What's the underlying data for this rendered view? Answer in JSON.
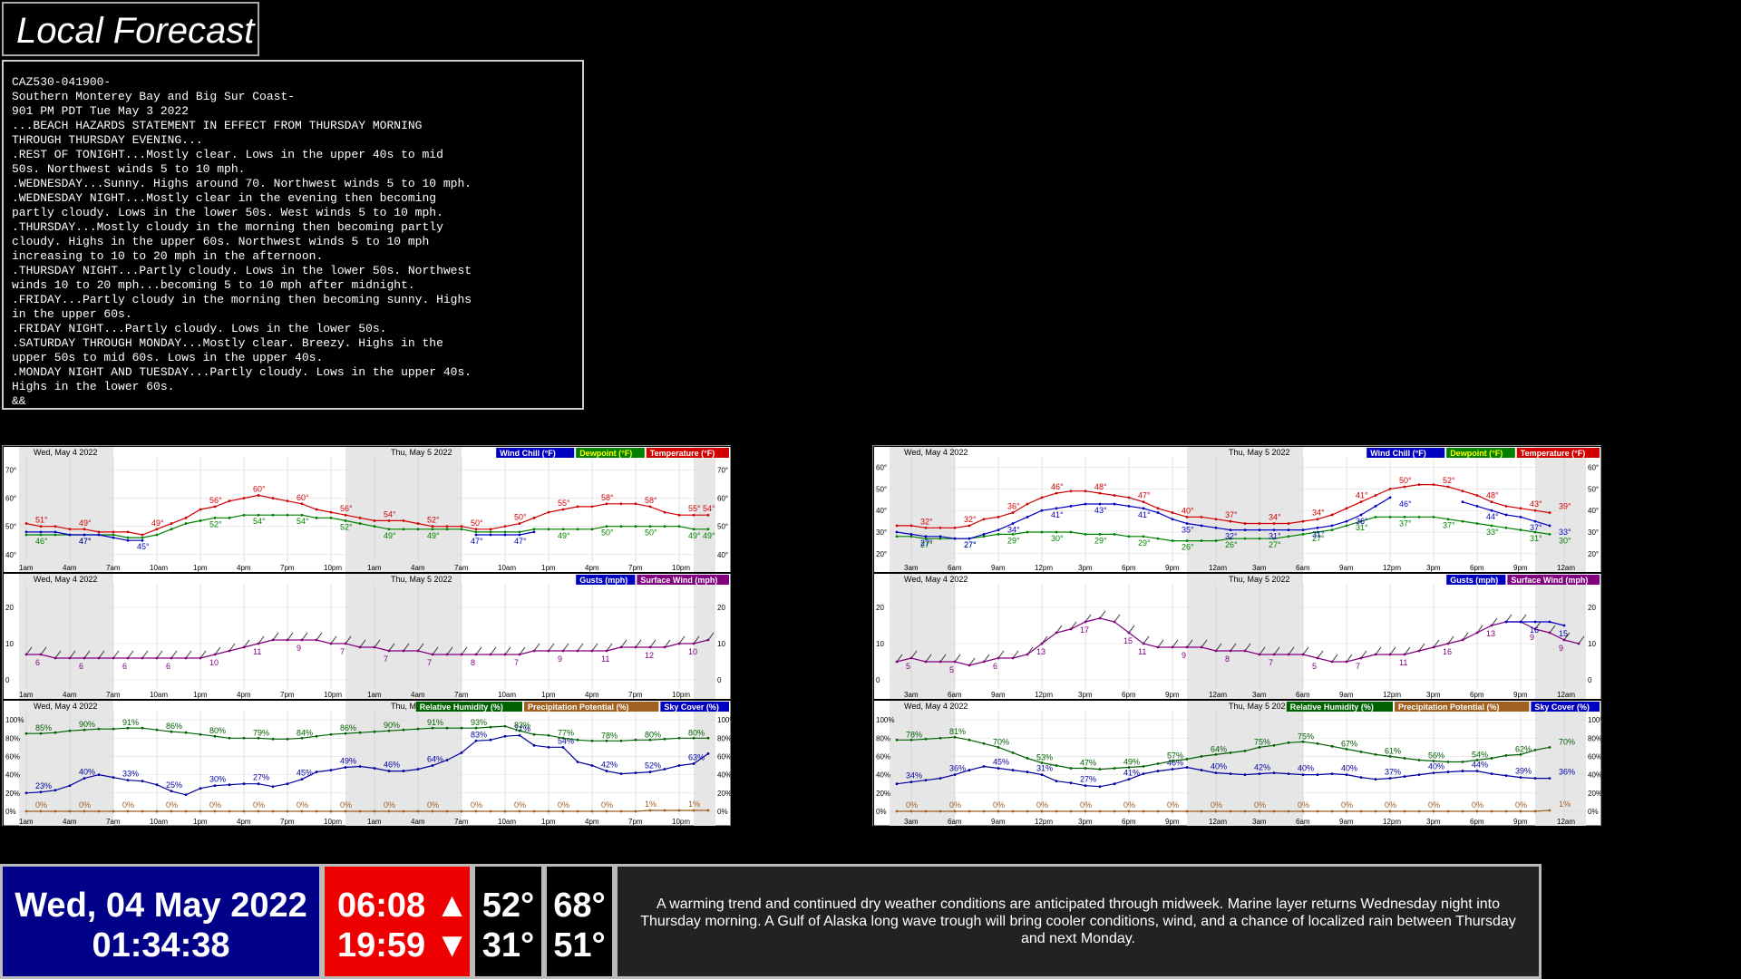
{
  "title": "Local Forecast",
  "afd_lines": [
    "CAZ530-041900-",
    "Southern Monterey Bay and Big Sur Coast-",
    "901 PM PDT Tue May 3 2022",
    "...BEACH HAZARDS STATEMENT IN EFFECT FROM THURSDAY MORNING",
    "THROUGH THURSDAY EVENING...",
    ".REST OF TONIGHT...Mostly clear. Lows in the upper 40s to mid",
    "50s. Northwest winds 5 to 10 mph.",
    ".WEDNESDAY...Sunny. Highs around 70. Northwest winds 5 to 10 mph.",
    ".WEDNESDAY NIGHT...Mostly clear in the evening then becoming",
    "partly cloudy. Lows in the lower 50s. West winds 5 to 10 mph.",
    ".THURSDAY...Mostly cloudy in the morning then becoming partly",
    "cloudy. Highs in the upper 60s. Northwest winds 5 to 10 mph",
    "increasing to 10 to 20 mph in the afternoon.",
    ".THURSDAY NIGHT...Partly cloudy. Lows in the lower 50s. Northwest",
    "winds 10 to 20 mph...becoming 5 to 10 mph after midnight.",
    ".FRIDAY...Partly cloudy in the morning then becoming sunny. Highs",
    "in the upper 60s.",
    ".FRIDAY NIGHT...Partly cloudy. Lows in the lower 50s.",
    ".SATURDAY THROUGH MONDAY...Mostly clear. Breezy. Highs in the",
    "upper 50s to mid 60s. Lows in the upper 40s.",
    ".MONDAY NIGHT AND TUESDAY...Partly cloudy. Lows in the upper 40s.",
    "Highs in the lower 60s.",
    "&&"
  ],
  "charts": [
    {
      "day1_label": "Wed, May 4 2022",
      "day2_label": "Thu, May 5 2022",
      "day2_label_short": "Thu, Ma",
      "time_labels": [
        "1am",
        "4am",
        "7am",
        "10am",
        "1pm",
        "4pm",
        "7pm",
        "10pm",
        "1am",
        "4am",
        "7am",
        "10am",
        "1pm",
        "4pm",
        "7pm",
        "10pm"
      ],
      "temp_axis": {
        "labels": [
          "70°",
          "60°",
          "50°",
          "40°"
        ],
        "values": [
          70,
          60,
          50,
          40
        ],
        "min": 38,
        "max": 74
      },
      "temp_legend": [
        "Wind Chill (°F)",
        "Dewpoint (°F)",
        "Temperature (°F)"
      ],
      "temperature": [
        51,
        50,
        50,
        49,
        49,
        48,
        48,
        48,
        47,
        49,
        51,
        53,
        56,
        57,
        59,
        60,
        61,
        60,
        59,
        58,
        56,
        55,
        54,
        53,
        52,
        52,
        52,
        51,
        50,
        50,
        50,
        49,
        49,
        50,
        51,
        53,
        55,
        56,
        57,
        57,
        58,
        58,
        58,
        57,
        55,
        54,
        54,
        54
      ],
      "temperature_labels": {
        "1": "51°",
        "4": "49°",
        "9": "49°",
        "13": "56°",
        "16": "60°",
        "19": "60°",
        "22": "56°",
        "25": "54°",
        "28": "52°",
        "31": "50°",
        "34": "50°",
        "37": "55°",
        "40": "58°",
        "43": "58°",
        "46": "55°",
        "47": "54°"
      },
      "windchill": [
        48,
        48,
        48,
        47,
        47,
        47,
        46,
        45,
        45
      ],
      "windchill_labels": {
        "4": "47°",
        "8": "45°"
      },
      "windchill2": [
        null,
        null,
        null,
        null,
        null,
        null,
        null,
        null,
        null,
        null,
        null,
        null,
        null,
        null,
        null,
        null,
        null,
        null,
        null,
        null,
        null,
        null,
        null,
        null,
        null,
        null,
        null,
        null,
        null,
        null,
        null,
        47,
        47,
        47,
        47,
        48
      ],
      "windchill2_labels": {
        "31": "47°",
        "34": "47°"
      },
      "dewpoint": [
        47,
        47,
        47,
        47,
        47,
        47,
        47,
        46,
        46,
        47,
        49,
        51,
        52,
        53,
        53,
        54,
        54,
        54,
        54,
        54,
        53,
        53,
        52,
        51,
        50,
        49,
        49,
        49,
        49,
        49,
        49,
        48,
        48,
        48,
        48,
        49,
        49,
        49,
        49,
        49,
        50,
        50,
        50,
        50,
        50,
        50,
        49,
        49
      ],
      "dewpoint_labels": {
        "1": "46°",
        "4": "47°",
        "13": "52°",
        "16": "54°",
        "19": "54°",
        "22": "52°",
        "25": "49°",
        "28": "49°",
        "37": "49°",
        "40": "50°",
        "43": "50°",
        "46": "49°",
        "47": "49°"
      },
      "wind_axis": {
        "labels": [
          "20",
          "10",
          "0"
        ],
        "values": [
          20,
          10,
          0
        ],
        "min": -2,
        "max": 26
      },
      "wind_legend": [
        "Gusts (mph)",
        "Surface Wind (mph)"
      ],
      "wind": [
        7,
        7,
        6,
        6,
        6,
        6,
        6,
        6,
        6,
        6,
        6,
        6,
        6,
        7,
        8,
        9,
        10,
        11,
        11,
        11,
        11,
        10,
        10,
        9,
        9,
        8,
        8,
        8,
        7,
        7,
        7,
        7,
        7,
        7,
        7,
        8,
        8,
        8,
        8,
        8,
        8,
        9,
        9,
        9,
        9,
        10,
        10,
        11,
        11,
        11,
        11,
        12,
        11,
        10,
        10
      ],
      "wind_labels": {
        "1": "6",
        "4": "6",
        "7": "6",
        "10": "6",
        "13": "10",
        "16": "11",
        "19": "9",
        "22": "7",
        "25": "7",
        "28": "7",
        "31": "8",
        "34": "7",
        "37": "9",
        "40": "11",
        "43": "12",
        "46": "10"
      },
      "pct_axis": {
        "labels": [
          "100%",
          "80%",
          "60%",
          "40%",
          "20%",
          "0%"
        ],
        "values": [
          100,
          80,
          60,
          40,
          20,
          0
        ],
        "min": -3,
        "max": 108
      },
      "pct_legend": [
        "Relative Humidity (%)",
        "Precipitation Potential (%)",
        "Sky Cover (%)"
      ],
      "humidity": [
        85,
        85,
        86,
        88,
        89,
        90,
        90,
        91,
        91,
        89,
        87,
        86,
        84,
        82,
        80,
        80,
        80,
        79,
        79,
        80,
        82,
        84,
        85,
        86,
        87,
        88,
        89,
        90,
        91,
        91,
        91,
        91,
        92,
        93,
        88,
        84,
        83,
        80,
        78,
        77,
        77,
        77,
        78,
        78,
        79,
        80,
        80,
        80
      ],
      "humidity_labels": {
        "1": "85%",
        "4": "90%",
        "7": "91%",
        "10": "86%",
        "13": "80%",
        "16": "79%",
        "19": "84%",
        "22": "86%",
        "25": "90%",
        "28": "91%",
        "31": "93%",
        "34": "83%",
        "37": "77%",
        "40": "78%",
        "43": "80%",
        "46": "80%"
      },
      "skycover": [
        20,
        21,
        23,
        28,
        36,
        40,
        37,
        34,
        33,
        29,
        22,
        18,
        25,
        28,
        29,
        30,
        30,
        27,
        30,
        35,
        43,
        45,
        48,
        49,
        47,
        44,
        44,
        46,
        50,
        56,
        64,
        77,
        78,
        82,
        83,
        72,
        70,
        70,
        54,
        50,
        44,
        41,
        42,
        43,
        46,
        50,
        52,
        63
      ],
      "skycover_labels": {
        "1": "23%",
        "4": "40%",
        "7": "33%",
        "10": "25%",
        "13": "30%",
        "16": "27%",
        "19": "45%",
        "22": "49%",
        "25": "46%",
        "28": "64%",
        "31": "83%",
        "34": "71%",
        "37": "54%",
        "40": "42%",
        "43": "52%",
        "46": "63%"
      },
      "precip_labels": {
        "1": "0%",
        "4": "0%",
        "7": "0%",
        "10": "0%",
        "13": "0%",
        "16": "0%",
        "19": "0%",
        "22": "0%",
        "25": "0%",
        "28": "0%",
        "31": "0%",
        "34": "0%",
        "37": "0%",
        "40": "0%",
        "43": "1%",
        "46": "1%"
      },
      "precip": [
        0,
        0,
        0,
        0,
        0,
        0,
        0,
        0,
        0,
        0,
        0,
        0,
        0,
        0,
        0,
        0,
        0,
        0,
        0,
        0,
        0,
        0,
        0,
        0,
        0,
        0,
        0,
        0,
        0,
        0,
        0,
        0,
        0,
        0,
        0,
        0,
        0,
        0,
        0,
        0,
        0,
        0,
        0,
        1,
        1,
        1,
        1,
        1
      ]
    },
    {
      "day1_label": "Wed, May 4 2022",
      "day2_label": "Thu, May 5 2022",
      "day2_label_short": "Thu, May 5 202",
      "time_labels": [
        "3am",
        "6am",
        "9am",
        "12pm",
        "3pm",
        "6pm",
        "9pm",
        "12am",
        "3am",
        "6am",
        "9am",
        "12pm",
        "3pm",
        "6pm",
        "9pm",
        "12am"
      ],
      "temp_axis": {
        "labels": [
          "60°",
          "50°",
          "40°",
          "30°",
          "20°"
        ],
        "values": [
          60,
          50,
          40,
          30,
          20
        ],
        "min": 17,
        "max": 64
      },
      "temp_legend": [
        "Wind Chill (°F)",
        "Dewpoint (°F)",
        "Temperature (°F)"
      ],
      "temperature": [
        33,
        33,
        32,
        32,
        32,
        33,
        36,
        37,
        39,
        43,
        46,
        48,
        49,
        49,
        48,
        47,
        46,
        44,
        41,
        39,
        37,
        37,
        36,
        35,
        34,
        34,
        34,
        34,
        35,
        36,
        38,
        41,
        44,
        47,
        50,
        51,
        52,
        52,
        51,
        49,
        47,
        44,
        42,
        41,
        40,
        39
      ],
      "temperature_labels": {
        "2": "32°",
        "5": "32°",
        "8": "36°",
        "11": "46°",
        "14": "48°",
        "17": "47°",
        "20": "40°",
        "23": "37°",
        "26": "34°",
        "29": "34°",
        "32": "41°",
        "35": "50°",
        "38": "52°",
        "41": "48°",
        "44": "43°",
        "46": "39°"
      },
      "windchill": [
        30,
        29,
        28,
        28,
        27,
        27,
        29,
        31,
        34,
        37,
        40,
        41,
        42,
        43,
        43,
        43,
        42,
        41,
        39,
        36,
        34,
        33,
        32,
        31,
        31,
        31,
        31,
        31,
        31,
        32,
        33,
        35,
        38,
        42,
        46
      ],
      "windchill_labels": {
        "2": "27°",
        "5": "27°",
        "8": "34°",
        "11": "41°",
        "14": "43°",
        "17": "41°",
        "20": "35°",
        "23": "32°",
        "26": "31°",
        "29": "31°",
        "32": "36°",
        "35": "46°"
      },
      "windchill2": [
        null,
        null,
        null,
        null,
        null,
        null,
        null,
        null,
        null,
        null,
        null,
        null,
        null,
        null,
        null,
        null,
        null,
        null,
        null,
        null,
        null,
        null,
        null,
        null,
        null,
        null,
        null,
        null,
        null,
        null,
        null,
        null,
        null,
        null,
        null,
        null,
        null,
        null,
        null,
        44,
        42,
        40,
        38,
        37,
        35,
        33
      ],
      "windchill2_labels": {
        "41": "44°",
        "44": "37°",
        "46": "33°"
      },
      "dewpoint": [
        28,
        28,
        27,
        27,
        27,
        27,
        28,
        29,
        29,
        30,
        30,
        30,
        30,
        29,
        29,
        29,
        28,
        28,
        27,
        26,
        26,
        26,
        26,
        27,
        27,
        27,
        27,
        28,
        29,
        30,
        31,
        33,
        35,
        37,
        37,
        37,
        37,
        37,
        36,
        35,
        34,
        33,
        32,
        31,
        30,
        29
      ],
      "dewpoint_labels": {
        "2": "27°",
        "5": "27°",
        "8": "29°",
        "11": "30°",
        "14": "29°",
        "17": "29°",
        "20": "26°",
        "23": "26°",
        "26": "27°",
        "29": "27°",
        "32": "31°",
        "35": "37°",
        "38": "37°",
        "41": "33°",
        "44": "31°",
        "46": "30°"
      },
      "wind_axis": {
        "labels": [
          "20",
          "10",
          "0"
        ],
        "values": [
          20,
          10,
          0
        ],
        "min": -2,
        "max": 26
      },
      "wind_legend": [
        "Gusts (mph)",
        "Surface Wind (mph)"
      ],
      "wind": [
        5,
        6,
        5,
        5,
        5,
        4,
        5,
        6,
        6,
        7,
        10,
        13,
        14,
        16,
        17,
        16,
        13,
        10,
        9,
        9,
        9,
        9,
        8,
        8,
        8,
        7,
        7,
        7,
        7,
        6,
        5,
        5,
        6,
        7,
        7,
        7,
        8,
        9,
        10,
        11,
        13,
        15,
        16,
        16,
        14,
        13,
        11,
        10,
        9,
        9,
        9,
        9
      ],
      "wind_labels": {
        "1": "5",
        "4": "5",
        "7": "6",
        "10": "13",
        "13": "17",
        "16": "15",
        "17": "11",
        "20": "9",
        "23": "8",
        "26": "7",
        "29": "5",
        "32": "7",
        "35": "11",
        "38": "16",
        "41": "13",
        "44": "9",
        "46": "9"
      },
      "gust": [
        null,
        null,
        null,
        null,
        null,
        null,
        null,
        null,
        null,
        null,
        null,
        null,
        null,
        null,
        null,
        null,
        null,
        null,
        null,
        null,
        null,
        null,
        null,
        null,
        null,
        null,
        null,
        null,
        null,
        null,
        null,
        null,
        null,
        null,
        null,
        null,
        null,
        null,
        null,
        null,
        null,
        null,
        16,
        16,
        16,
        16,
        15
      ],
      "gust_labels": {
        "44": "16",
        "46": "15"
      },
      "pct_axis": {
        "labels": [
          "100%",
          "80%",
          "60%",
          "40%",
          "20%",
          "0%"
        ],
        "values": [
          100,
          80,
          60,
          40,
          20,
          0
        ],
        "min": -3,
        "max": 108
      },
      "pct_legend": [
        "Relative Humidity (%)",
        "Precipitation Potential (%)",
        "Sky Cover (%)"
      ],
      "humidity": [
        78,
        78,
        79,
        80,
        81,
        78,
        74,
        70,
        64,
        58,
        53,
        50,
        47,
        47,
        46,
        47,
        48,
        49,
        52,
        55,
        57,
        60,
        62,
        64,
        66,
        70,
        72,
        75,
        76,
        74,
        71,
        68,
        65,
        62,
        60,
        58,
        56,
        55,
        54,
        54,
        56,
        58,
        61,
        62,
        67,
        70
      ],
      "humidity_labels": {
        "1": "78%",
        "4": "81%",
        "7": "70%",
        "10": "53%",
        "13": "47%",
        "16": "49%",
        "19": "57%",
        "22": "64%",
        "25": "75%",
        "28": "75%",
        "31": "67%",
        "34": "61%",
        "37": "56%",
        "40": "54%",
        "43": "62%",
        "46": "70%"
      },
      "skycover": [
        30,
        32,
        34,
        36,
        40,
        45,
        49,
        47,
        45,
        43,
        40,
        33,
        31,
        28,
        27,
        30,
        35,
        41,
        44,
        46,
        48,
        45,
        42,
        41,
        40,
        41,
        42,
        41,
        40,
        40,
        41,
        40,
        37,
        35,
        36,
        38,
        40,
        42,
        43,
        44,
        44,
        41,
        39,
        37,
        36,
        36
      ],
      "skycover_labels": {
        "1": "34%",
        "4": "36%",
        "7": "45%",
        "10": "31%",
        "13": "27%",
        "16": "41%",
        "19": "46%",
        "22": "40%",
        "25": "42%",
        "28": "40%",
        "31": "40%",
        "34": "37%",
        "37": "40%",
        "40": "44%",
        "43": "39%",
        "46": "36%"
      },
      "precip_labels": {
        "1": "0%",
        "4": "0%",
        "7": "0%",
        "10": "0%",
        "13": "0%",
        "16": "0%",
        "19": "0%",
        "22": "0%",
        "25": "0%",
        "28": "0%",
        "31": "0%",
        "34": "0%",
        "37": "0%",
        "40": "0%",
        "43": "0%",
        "46": "1%"
      },
      "precip": [
        0,
        0,
        0,
        0,
        0,
        0,
        0,
        0,
        0,
        0,
        0,
        0,
        0,
        0,
        0,
        0,
        0,
        0,
        0,
        0,
        0,
        0,
        0,
        0,
        0,
        0,
        0,
        0,
        0,
        0,
        0,
        0,
        0,
        0,
        0,
        0,
        0,
        0,
        0,
        0,
        0,
        0,
        0,
        0,
        0,
        1
      ]
    }
  ],
  "bottom": {
    "date": "Wed, 04 May 2022",
    "time": "01:34:38",
    "sunrise": "06:08 ▲",
    "sunset": "19:59 ▼",
    "temp_a_top": "52°",
    "temp_a_bottom": "31°",
    "temp_b_top": "68°",
    "temp_b_bottom": "51°",
    "discussion": "A warming trend and continued dry weather conditions are anticipated through midweek. Marine layer returns Wednesday night into Thursday morning. A Gulf of Alaska long wave trough will bring cooler conditions, wind, and a chance of localized rain between Thursday and next Monday."
  },
  "colors": {
    "temperature": "#d00000",
    "dewpoint": "#008000",
    "windchill": "#0000c0",
    "wind": "#800080",
    "precip": "#a06020",
    "humidity": "#006000",
    "skycover": "#0000a0",
    "night_shade": "#e6e6e6"
  }
}
